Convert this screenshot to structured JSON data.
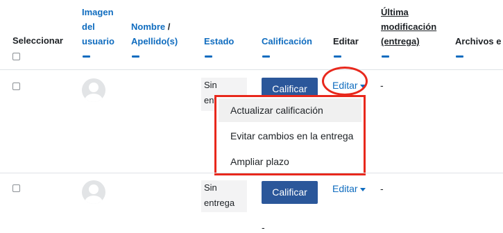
{
  "header": {
    "select": "Seleccionar",
    "image_line1": "Imagen",
    "image_line2": "del",
    "image_line3": "usuario",
    "name": "Nombre",
    "name_sep": " /",
    "surname": "Apellido(s)",
    "status": "Estado",
    "grade": "Calificación",
    "edit": "Editar",
    "lastmod_line1": "Última",
    "lastmod_line2": "modificación",
    "lastmod_line3": "(entrega)",
    "files": "Archivos e"
  },
  "rows": [
    {
      "status_line1": "Sin",
      "status_line2": "entrega",
      "grade_button": "Calificar",
      "edit_link": "Editar",
      "lastmod": "-"
    },
    {
      "status_line1": "Sin",
      "status_line2": "entrega",
      "grade_button": "Calificar",
      "edit_link": "Editar",
      "lastmod": "-",
      "extra": "-"
    }
  ],
  "edit_menu": {
    "items": [
      "Actualizar calificación",
      "Evitar cambios en la entrega",
      "Ampliar plazo"
    ]
  },
  "colors": {
    "link": "#0f6cbf",
    "button": "#2b579a",
    "highlight": "#e8281c"
  }
}
